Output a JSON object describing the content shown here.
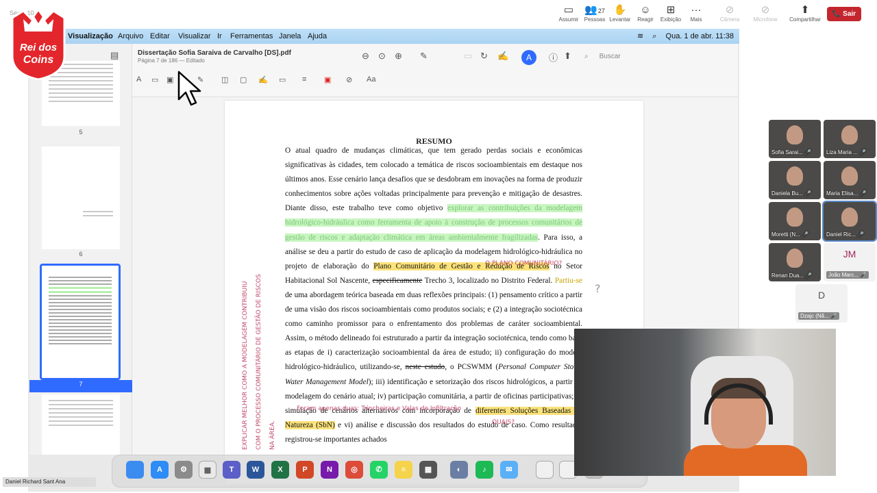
{
  "meeting": {
    "title": "Sexta 10",
    "buttons": [
      {
        "label": "Assumir",
        "icon": "screen-icon"
      },
      {
        "label": "Pessoas",
        "icon": "people-icon",
        "count": "27"
      },
      {
        "label": "Levantar",
        "icon": "hand-icon"
      },
      {
        "label": "Reagir",
        "icon": "emoji-icon"
      },
      {
        "label": "Exibição",
        "icon": "grid-icon"
      },
      {
        "label": "Mais",
        "icon": "more-icon"
      },
      {
        "label": "Câmera",
        "icon": "camera-off-icon"
      },
      {
        "label": "Microfone",
        "icon": "mic-off-icon"
      },
      {
        "label": "Compartilhar",
        "icon": "share-icon"
      }
    ],
    "leave_label": "Sair",
    "leave_color": "#c4262e"
  },
  "logo": {
    "line1": "Rei dos",
    "line2": "Coins"
  },
  "mac": {
    "menu": [
      "Visualização",
      "Arquivo",
      "Editar",
      "Visualizar",
      "Ir",
      "Ferramentas",
      "Janela",
      "Ajuda"
    ],
    "clock": "Qua. 1 de abr.  11:38"
  },
  "doc": {
    "title": "Dissertação Sofia Saraiva de Carvalho [DS].pdf",
    "subtitle": "Página 7 de 186 — Editado",
    "search_placeholder": "Buscar",
    "page_labels": [
      "5",
      "6",
      "7"
    ],
    "heading": "RESUMO",
    "p1": "O atual quadro de mudanças climáticas, que tem gerado perdas sociais e econômicas significativas às cidades, tem colocado a temática de riscos socioambientais em destaque nos últimos anos. Esse cenário lança desafios que se desdobram em inovações na forma de produzir conhecimentos sobre ações voltadas principalmente para prevenção e mitigação de desastres. Diante disso, este trabalho teve como objetivo ",
    "p1_green": "explorar as contribuições da modelagem hidrológico-hidráulica como ferramenta de apoio à construção de processos comunitários de gestão de riscos e adaptação climática em áreas ambientalmente fragilizadas",
    "p1_b": ". Para isso, a análise se deu a partir do estudo de caso de aplicação da modelagem hidrológico-hidráulica no projeto de elaboração do ",
    "p1_yellow": "Plano Comunitário de Gestão e Redução de Riscos",
    "p1_c": " no Setor Habitacional Sol Nascente, ",
    "p1_strike": "especificamente",
    "p1_d": " Trecho 3, localizado no Distrito Federal. ",
    "p1_pk": "Partiu-se",
    "p1_e": " de uma abordagem teórica baseada em duas reflexões principais: (1) pensamento crítico a partir de uma visão dos riscos socioambientais como produtos sociais; e (2) a integração sociotécnica como caminho promissor para o enfrentamento dos problemas de caráter socioambiental. Assim, o método delineado foi estruturado a partir da integração sociotécnica, tendo como base as etapas de i) caracterização socioambiental da área de estudo; ii) configuração do modelo hidrológico-hidráulico, utilizando-se, ",
    "p1_strike2": "neste estudo",
    "p1_f": ", o PCSWMM (",
    "p1_ital": "Personal Computer Storm Water Management Model",
    "p1_g": "); iii) identificação e setorização dos riscos hidrológicos, a partir da modelagem do cenário atual; iv) participação comunitária, a partir de oficinas participativas; v) simulação de cenários alternativos com incorporação de ",
    "p1_yellow2": "diferentes Soluções Baseadas na Natureza (SbN)",
    "p1_h": " e vi) análise e discussão dos resultados do estudo de caso. Como resultado, registrou-se importantes achados",
    "notes": {
      "plano": "O PLANO COMUNITÁRIO?",
      "q": "?",
      "forams": "Foram apenas duas: Trincheiras e Valas de Infiltração",
      "quais": "QUAIS?",
      "vertical": "EXPLICAR MELHOR COMO A MODELAGEM CONTRIBUIU COM O PROCESSO COMUNITÁRIO DE GESTÃO DE RISCOS NA ÁREA."
    }
  },
  "dock": [
    {
      "name": "finder-icon",
      "color": "#3b8cf0",
      "label": ""
    },
    {
      "name": "app-store-icon",
      "color": "#2d8cf5",
      "label": "A"
    },
    {
      "name": "settings-icon",
      "color": "#8b8b8b",
      "label": "⚙"
    },
    {
      "name": "launchpad-icon",
      "color": "#e9e9e9",
      "label": "▦"
    },
    {
      "name": "teams-icon",
      "color": "#5b5fc7",
      "label": "T"
    },
    {
      "name": "word-icon",
      "color": "#2b579a",
      "label": "W"
    },
    {
      "name": "excel-icon",
      "color": "#217346",
      "label": "X"
    },
    {
      "name": "powerpoint-icon",
      "color": "#d24726",
      "label": "P"
    },
    {
      "name": "onenote-icon",
      "color": "#7719aa",
      "label": "N"
    },
    {
      "name": "chrome-icon",
      "color": "#dd4b39",
      "label": "◎"
    },
    {
      "name": "whatsapp-icon",
      "color": "#25d366",
      "label": "✆"
    },
    {
      "name": "notes-icon",
      "color": "#f5d34a",
      "label": "≡"
    },
    {
      "name": "calculator-icon",
      "color": "#555",
      "label": "▦"
    },
    {
      "name": "preview-icon",
      "color": "#6a7fa3",
      "label": "◐"
    },
    {
      "name": "spotify-icon",
      "color": "#1db954",
      "label": "♪"
    },
    {
      "name": "mail-icon",
      "color": "#5ab0f7",
      "label": "✉"
    },
    {
      "name": "document-icon",
      "color": "#f0f0f0",
      "label": ""
    },
    {
      "name": "document2-icon",
      "color": "#f0f0f0",
      "label": ""
    },
    {
      "name": "trash-icon",
      "color": "#c0c0c0",
      "label": ""
    }
  ],
  "participants": [
    {
      "name": "Sofia Sarai...",
      "style": "face"
    },
    {
      "name": "Liza Maria ...",
      "style": "face"
    },
    {
      "name": "Daniela Bu...",
      "style": "face"
    },
    {
      "name": "Maria Elisa...",
      "style": "face"
    },
    {
      "name": "Moretti (N...",
      "style": "face"
    },
    {
      "name": "Daniel Ric...",
      "style": "face"
    },
    {
      "name": "Renan Dua...",
      "style": "face"
    },
    {
      "name": "João Marc...",
      "style": "initials",
      "initials": "JM"
    },
    {
      "name": "Dzajc (Nã...",
      "style": "initials",
      "initials": "D"
    }
  ],
  "presenter_name": "Daniel Richard Sant Ana"
}
